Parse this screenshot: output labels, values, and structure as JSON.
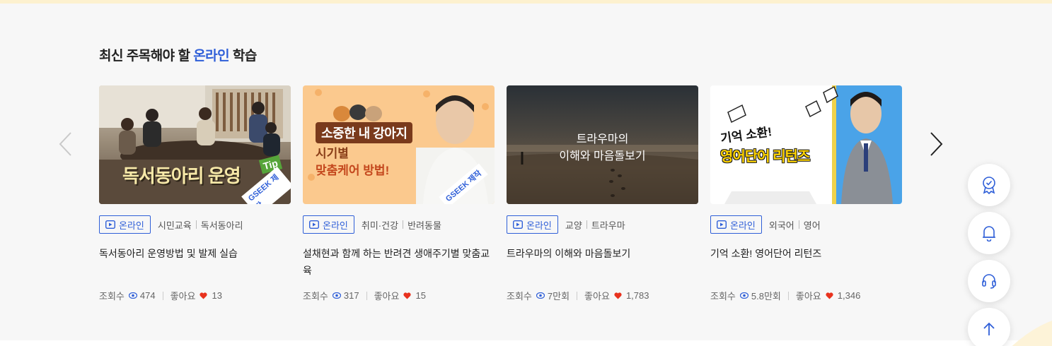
{
  "section": {
    "title_prefix": "최신 주목해야 할 ",
    "title_accent": "온라인",
    "title_suffix": " 학습"
  },
  "cards": [
    {
      "thumb_text": "독서동아리 운영",
      "thumb_tip": "Tip",
      "thumb_seal": "GSEEK 제작",
      "badge": "온라인",
      "category1": "시민교육",
      "category2": "독서동아리",
      "title": "독서동아리 운영방법 및 발제 실습",
      "views_label": "조회수",
      "views": "474",
      "likes_label": "좋아요",
      "likes": "13"
    },
    {
      "thumb_line1": "소중한 내 강아지",
      "thumb_line2": "시기별",
      "thumb_line3": "맞춤케어 방법!",
      "thumb_seal": "GSEEK 제작",
      "badge": "온라인",
      "category1": "취미·건강",
      "category2": "반려동물",
      "title": "설채현과 함께 하는 반려견 생애주기별 맞춤교육",
      "views_label": "조회수",
      "views": "317",
      "likes_label": "좋아요",
      "likes": "15"
    },
    {
      "thumb_line1": "트라우마의",
      "thumb_line2": "이해와 마음돌보기",
      "badge": "온라인",
      "category1": "교양",
      "category2": "트라우마",
      "title": "트라우마의 이해와 마음돌보기",
      "views_label": "조회수",
      "views": "7만회",
      "likes_label": "좋아요",
      "likes": "1,783"
    },
    {
      "thumb_line1": "기억 소환!",
      "thumb_line2": "영어단어 리턴즈",
      "badge": "온라인",
      "category1": "외국어",
      "category2": "영어",
      "title": "기억 소환! 영어단어 리턴즈",
      "views_label": "조회수",
      "views": "5.8만회",
      "likes_label": "좋아요",
      "likes": "1,346"
    }
  ],
  "colors": {
    "accent": "#2f5fd8",
    "heart": "#e8321e",
    "background": "#f7f7f7"
  },
  "icons": {
    "prev": "chevron-left-icon",
    "next": "chevron-right-icon",
    "fab1": "certificate-icon",
    "fab2": "bell-icon",
    "fab3": "headset-icon",
    "fab4": "arrow-up-icon"
  }
}
